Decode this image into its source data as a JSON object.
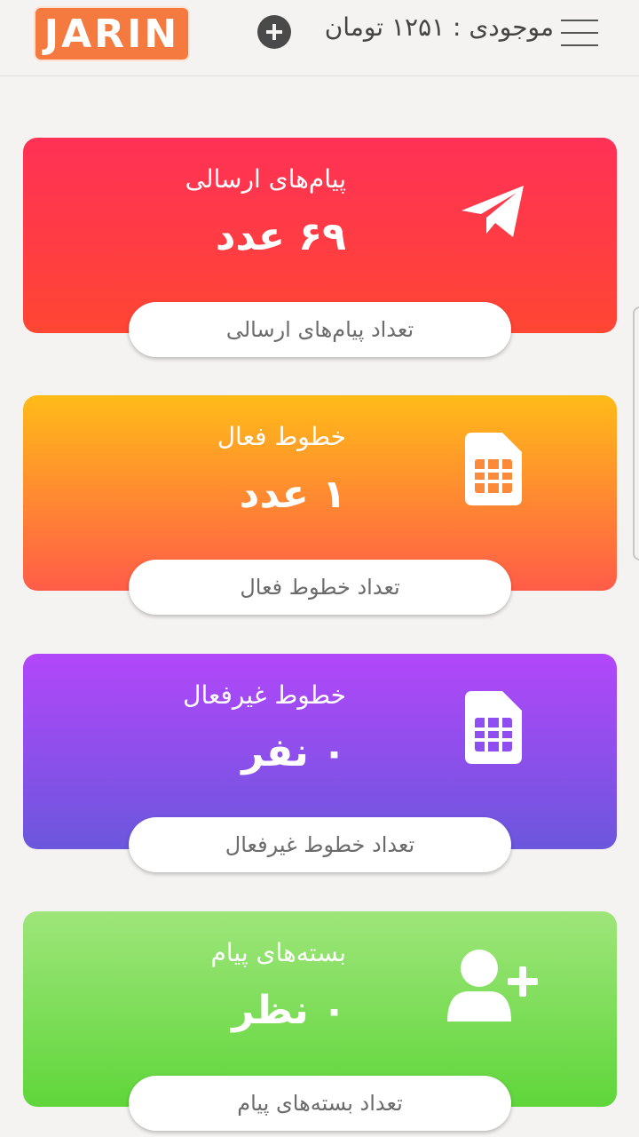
{
  "header": {
    "logo_text": "JARIN",
    "balance_text": "موجودی : ۱۲۵۱ تومان",
    "add_credit_icon": "plus-circle-icon",
    "menu_icon": "hamburger-menu-icon"
  },
  "cards": [
    {
      "title": "پیام‌های ارسالی",
      "value": "۶۹ عدد",
      "footer": "تعداد پیام‌های ارسالی",
      "icon": "paper-plane-icon",
      "gradient": [
        "#ff3156",
        "#ff4633"
      ]
    },
    {
      "title": "خطوط فعال",
      "value": "۱ عدد",
      "footer": "تعداد خطوط فعال",
      "icon": "sim-card-icon",
      "gradient": [
        "#ffbb18",
        "#ff5c48"
      ]
    },
    {
      "title": "خطوط غیرفعال",
      "value": "۰ نفر",
      "footer": "تعداد خطوط غیرفعال",
      "icon": "sim-card-icon",
      "gradient": [
        "#b247fa",
        "#6b57dd"
      ]
    },
    {
      "title": "بسته‌های پیام",
      "value": "۰ نظر",
      "footer": "تعداد بسته‌های پیام",
      "icon": "user-plus-icon",
      "gradient": [
        "#9ee57a",
        "#5fd63a"
      ]
    }
  ]
}
